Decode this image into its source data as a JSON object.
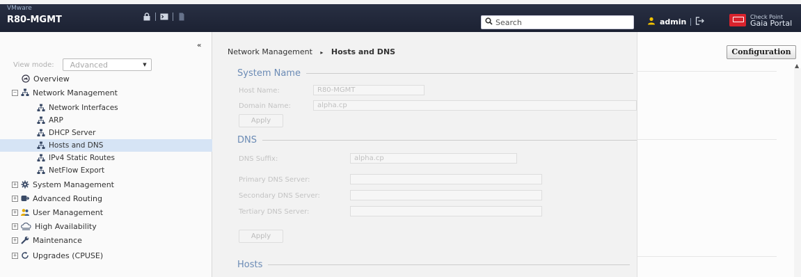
{
  "header": {
    "vendor": "VMware",
    "hostname": "R80-MGMT",
    "search_placeholder": "Search",
    "user": "admin",
    "brand_line1": "Check Point",
    "brand_line2": "Gaia Portal"
  },
  "sidebar": {
    "collapse_label": "«",
    "view_mode_label": "View mode:",
    "view_mode_value": "Advanced",
    "items": [
      {
        "label": "Overview"
      },
      {
        "label": "Network Management"
      },
      {
        "label": "Network Interfaces"
      },
      {
        "label": "ARP"
      },
      {
        "label": "DHCP Server"
      },
      {
        "label": "Hosts and DNS"
      },
      {
        "label": "IPv4 Static Routes"
      },
      {
        "label": "NetFlow Export"
      },
      {
        "label": "System Management"
      },
      {
        "label": "Advanced Routing"
      },
      {
        "label": "User Management"
      },
      {
        "label": "High Availability"
      },
      {
        "label": "Maintenance"
      },
      {
        "label": "Upgrades (CPUSE)"
      }
    ]
  },
  "breadcrumb": {
    "parent": "Network Management",
    "separator": "▸",
    "current": "Hosts and DNS"
  },
  "system_name": {
    "title": "System Name",
    "host_name_label": "Host Name:",
    "host_name_value": "R80-MGMT",
    "domain_name_label": "Domain Name:",
    "domain_name_value": "alpha.cp",
    "apply_label": "Apply"
  },
  "dns": {
    "title": "DNS",
    "suffix_label": "DNS Suffix:",
    "suffix_value": "alpha.cp",
    "primary_label": "Primary DNS Server:",
    "primary_value": "",
    "secondary_label": "Secondary DNS Server:",
    "secondary_value": "",
    "tertiary_label": "Tertiary DNS Server:",
    "tertiary_value": "",
    "apply_label": "Apply"
  },
  "hosts": {
    "title": "Hosts"
  },
  "right_panel": {
    "configuration_label": "Configuration"
  },
  "colors": {
    "header_bg": "#1c2233",
    "section_title": "#6b8bb5",
    "selected_row": "#d6e4f5",
    "brand_red": "#d9232d"
  }
}
